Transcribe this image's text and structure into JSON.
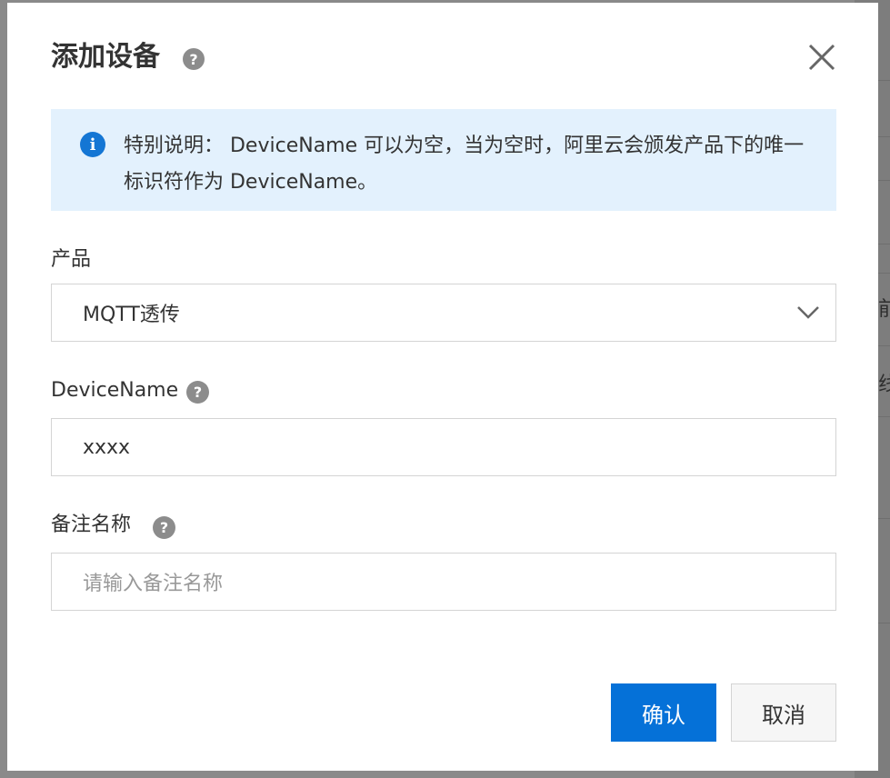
{
  "dialog": {
    "title": "添加设备",
    "help_glyph": "?",
    "close_icon": "close-icon"
  },
  "notice": {
    "icon": "info-icon",
    "glyph": "i",
    "text": "特别说明： DeviceName 可以为空，当为空时，阿里云会颁发产品下的唯一标识符作为 DeviceName。"
  },
  "form": {
    "product": {
      "label": "产品",
      "value": "MQTT透传"
    },
    "device_name": {
      "label": "DeviceName",
      "value": "xxxx"
    },
    "remark": {
      "label": "备注名称",
      "placeholder": "请输入备注名称"
    }
  },
  "buttons": {
    "confirm": "确认",
    "cancel": "取消"
  },
  "background": {
    "glyph_1": "前",
    "glyph_2": "线"
  },
  "colors": {
    "primary": "#0571d8",
    "notice_bg": "#e3f1fd",
    "info_icon": "#1476d4"
  }
}
